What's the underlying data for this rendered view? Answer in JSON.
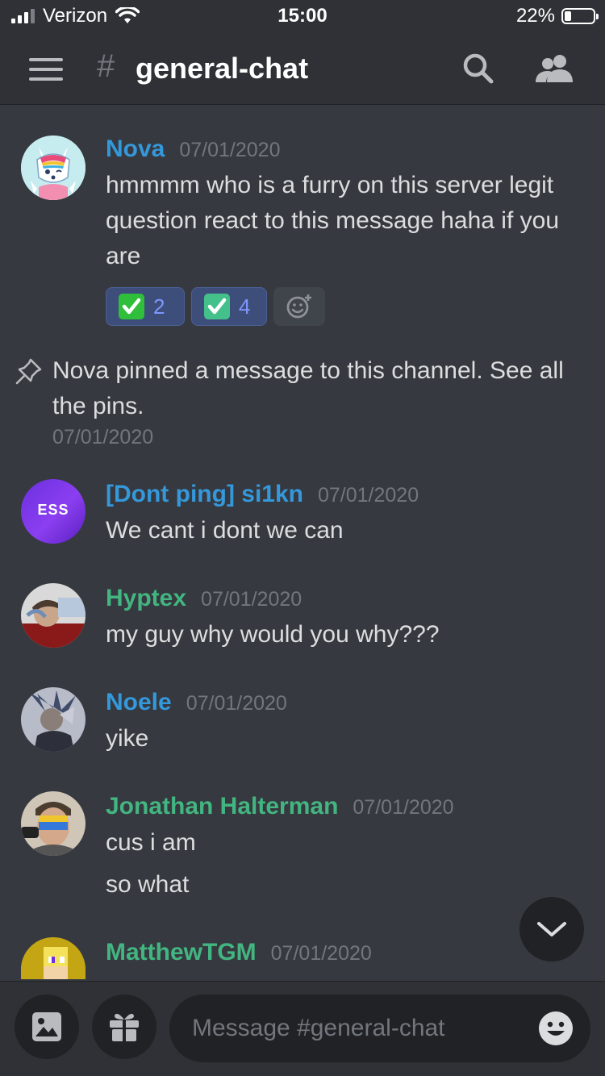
{
  "status_bar": {
    "carrier": "Verizon",
    "time": "15:00",
    "battery": "22%"
  },
  "header": {
    "hash": "#",
    "channel_name": "general-chat"
  },
  "messages": [
    {
      "username": "Nova",
      "timestamp": "07/01/2020",
      "username_color": "#3498db",
      "lines": [
        "hmmmm who is a furry on this server legit question react to this message haha if you are"
      ],
      "reactions": [
        {
          "emoji": "green-check-box",
          "count": "2"
        },
        {
          "emoji": "teal-check-mark",
          "count": "4"
        }
      ]
    },
    {
      "username": "[Dont ping] si1kn",
      "timestamp": "07/01/2020",
      "username_color": "#3498db",
      "avatar_text": "ESS",
      "lines": [
        "We cant i dont we can"
      ]
    },
    {
      "username": "Hyptex",
      "timestamp": "07/01/2020",
      "username_color": "#43b581",
      "lines": [
        "my guy why would you why???"
      ]
    },
    {
      "username": "Noele",
      "timestamp": "07/01/2020",
      "username_color": "#3498db",
      "lines": [
        "yike"
      ]
    },
    {
      "username": "Jonathan Halterman",
      "timestamp": "07/01/2020",
      "username_color": "#43b581",
      "lines": [
        "cus i am",
        "so what"
      ]
    },
    {
      "username": "MatthewTGM",
      "timestamp": "07/01/2020",
      "username_color": "#43b581",
      "lines": []
    }
  ],
  "system_pin": {
    "text": "Nova pinned a message to this channel. See all the pins.",
    "timestamp": "07/01/2020"
  },
  "composer": {
    "placeholder": "Message #general-chat"
  },
  "icons": [
    "menu-icon",
    "search-icon",
    "members-icon",
    "pin-icon",
    "add-reaction-icon",
    "chevron-down-icon",
    "image-icon",
    "gift-icon",
    "emoji-icon"
  ]
}
